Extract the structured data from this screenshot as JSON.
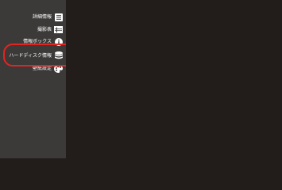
{
  "sidebar": {
    "items": [
      {
        "label": "詳細情報",
        "icon": "list-icon"
      },
      {
        "label": "撮影表",
        "icon": "table-icon"
      },
      {
        "label": "情報ボックス",
        "icon": "info-icon"
      },
      {
        "label": "ハードディスク情報",
        "icon": "hard-disk-stack-icon"
      },
      {
        "label": "壁紙設定",
        "icon": "palette-icon"
      }
    ]
  },
  "highlight": {
    "target": "ハードディスク情報",
    "color": "#e32421"
  }
}
